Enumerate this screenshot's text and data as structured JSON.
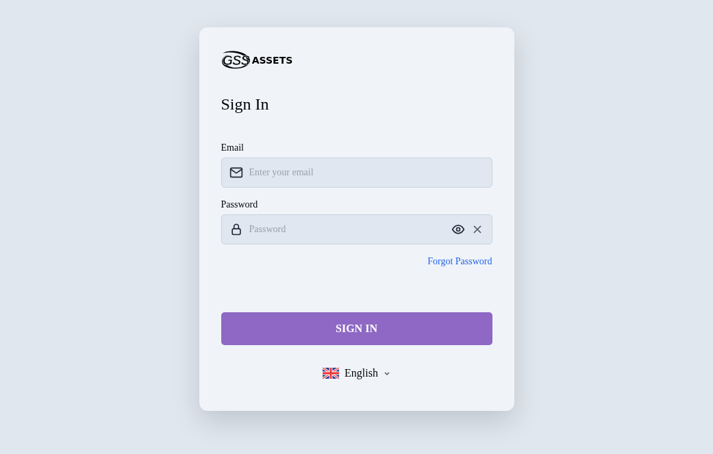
{
  "logo": {
    "mark": "GSS",
    "text": "ASSETS"
  },
  "title": "Sign In",
  "email": {
    "label": "Email",
    "placeholder": "Enter your email"
  },
  "password": {
    "label": "Password",
    "placeholder": "Password"
  },
  "forgot_link": "Forgot Password",
  "submit": "SIGN IN",
  "language": "English"
}
